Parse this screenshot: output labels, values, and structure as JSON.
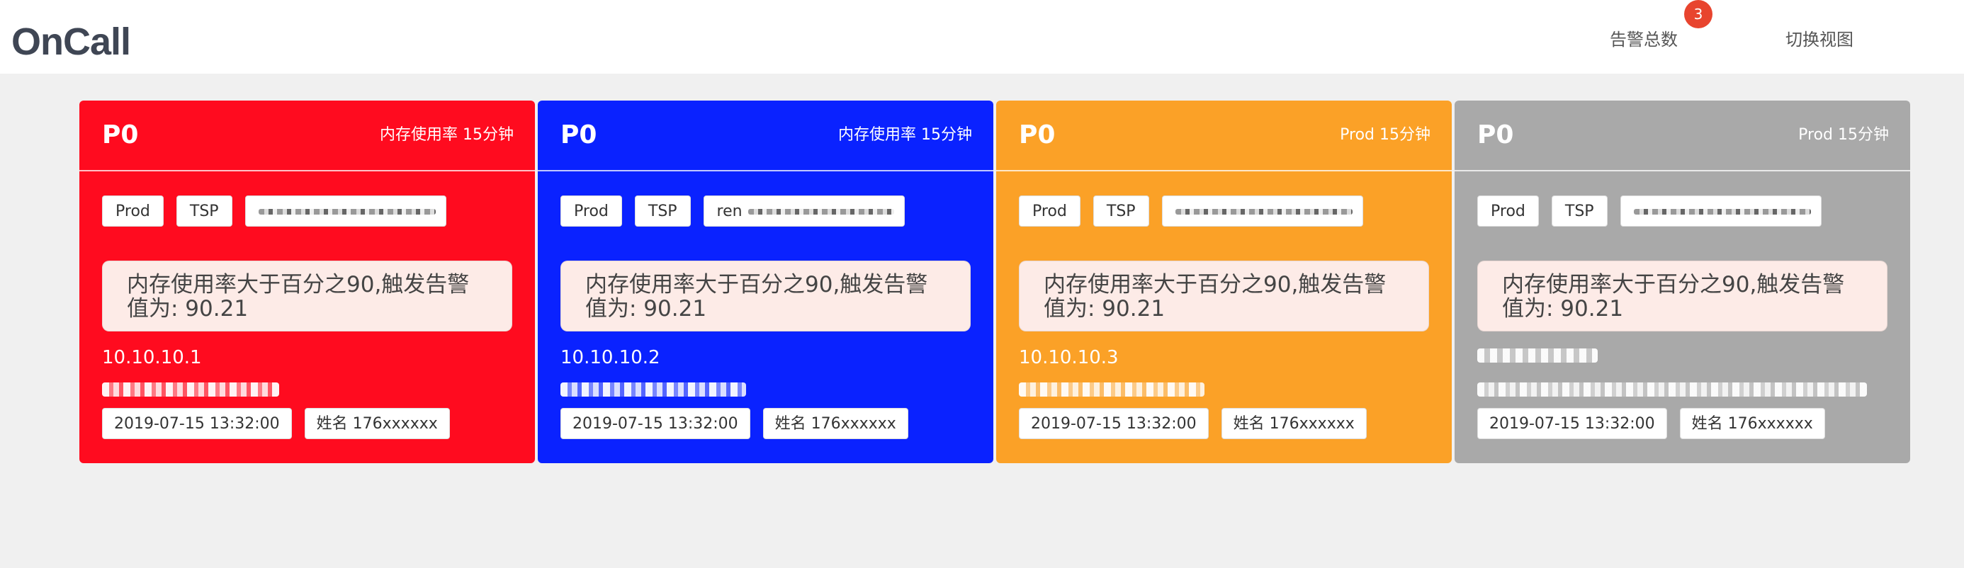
{
  "app": {
    "title": "OnCall"
  },
  "nav": {
    "total_label": "告警总数",
    "total_count": "3",
    "switch_label": "切换视图"
  },
  "colors": {
    "badge": "#e8442e",
    "red": "#ff0b1f",
    "blue": "#0a22ff",
    "orange": "#fba127",
    "gray": "#a9a9a9",
    "message_bg": "#fdebe7"
  },
  "cards": [
    {
      "color": "#ff0b1f",
      "level": "P0",
      "rule": "内存使用率 15分钟",
      "tags": [
        "Prod",
        "TSP"
      ],
      "host_prefix": "",
      "message": "内存使用率大于百分之90,触发告警值为: 90.21",
      "ip": "10.10.10.1",
      "time": "2019-07-15 13:32:00",
      "person": "姓名 176xxxxxx"
    },
    {
      "color": "#0a22ff",
      "level": "P0",
      "rule": "内存使用率 15分钟",
      "tags": [
        "Prod",
        "TSP"
      ],
      "host_prefix": "ren",
      "message": "内存使用率大于百分之90,触发告警值为: 90.21",
      "ip": "10.10.10.2",
      "time": "2019-07-15 13:32:00",
      "person": "姓名 176xxxxxx"
    },
    {
      "color": "#fba127",
      "level": "P0",
      "rule": "Prod 15分钟",
      "tags": [
        "Prod",
        "TSP"
      ],
      "host_prefix": "",
      "message": "内存使用率大于百分之90,触发告警值为: 90.21",
      "ip": "10.10.10.3",
      "time": "2019-07-15 13:32:00",
      "person": "姓名 176xxxxxx"
    },
    {
      "color": "#a9a9a9",
      "level": "P0",
      "rule": "Prod 15分钟",
      "tags": [
        "Prod",
        "TSP"
      ],
      "host_prefix": "",
      "message": "内存使用率大于百分之90,触发告警值为: 90.21",
      "ip": "",
      "time": "2019-07-15 13:32:00",
      "person": "姓名 176xxxxxx"
    }
  ]
}
